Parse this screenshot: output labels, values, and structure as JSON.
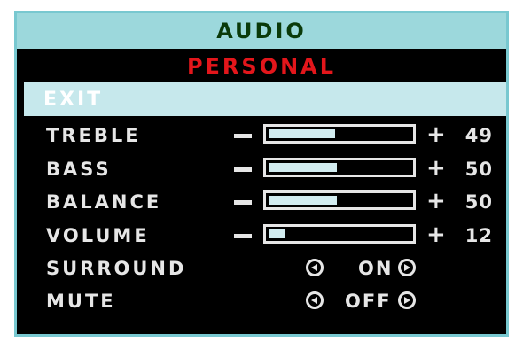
{
  "menu": {
    "title": "AUDIO",
    "mode": "PERSONAL",
    "exit_label": "EXIT",
    "colors": {
      "title_bg": "#9cd8dc",
      "title_text": "#0a3a0a",
      "mode_text": "#e3161b",
      "highlight_bg": "#c6e8ec",
      "item_text": "#e6e6e6",
      "border": "#78c8d0"
    }
  },
  "sliders": [
    {
      "label": "TREBLE",
      "value": "49",
      "level": 0.49,
      "minus": "−",
      "plus": "+"
    },
    {
      "label": "BASS",
      "value": "50",
      "level": 0.5,
      "minus": "−",
      "plus": "+"
    },
    {
      "label": "BALANCE",
      "value": "50",
      "level": 0.5,
      "minus": "−",
      "plus": "+"
    },
    {
      "label": "VOLUME",
      "value": "12",
      "level": 0.12,
      "minus": "−",
      "plus": "+"
    }
  ],
  "options": [
    {
      "label": "SURROUND",
      "value": "ON",
      "left_icon": "arrow-left-icon",
      "right_icon": "arrow-right-icon"
    },
    {
      "label": "MUTE",
      "value": "OFF",
      "left_icon": "arrow-left-icon",
      "right_icon": "arrow-right-icon"
    }
  ]
}
